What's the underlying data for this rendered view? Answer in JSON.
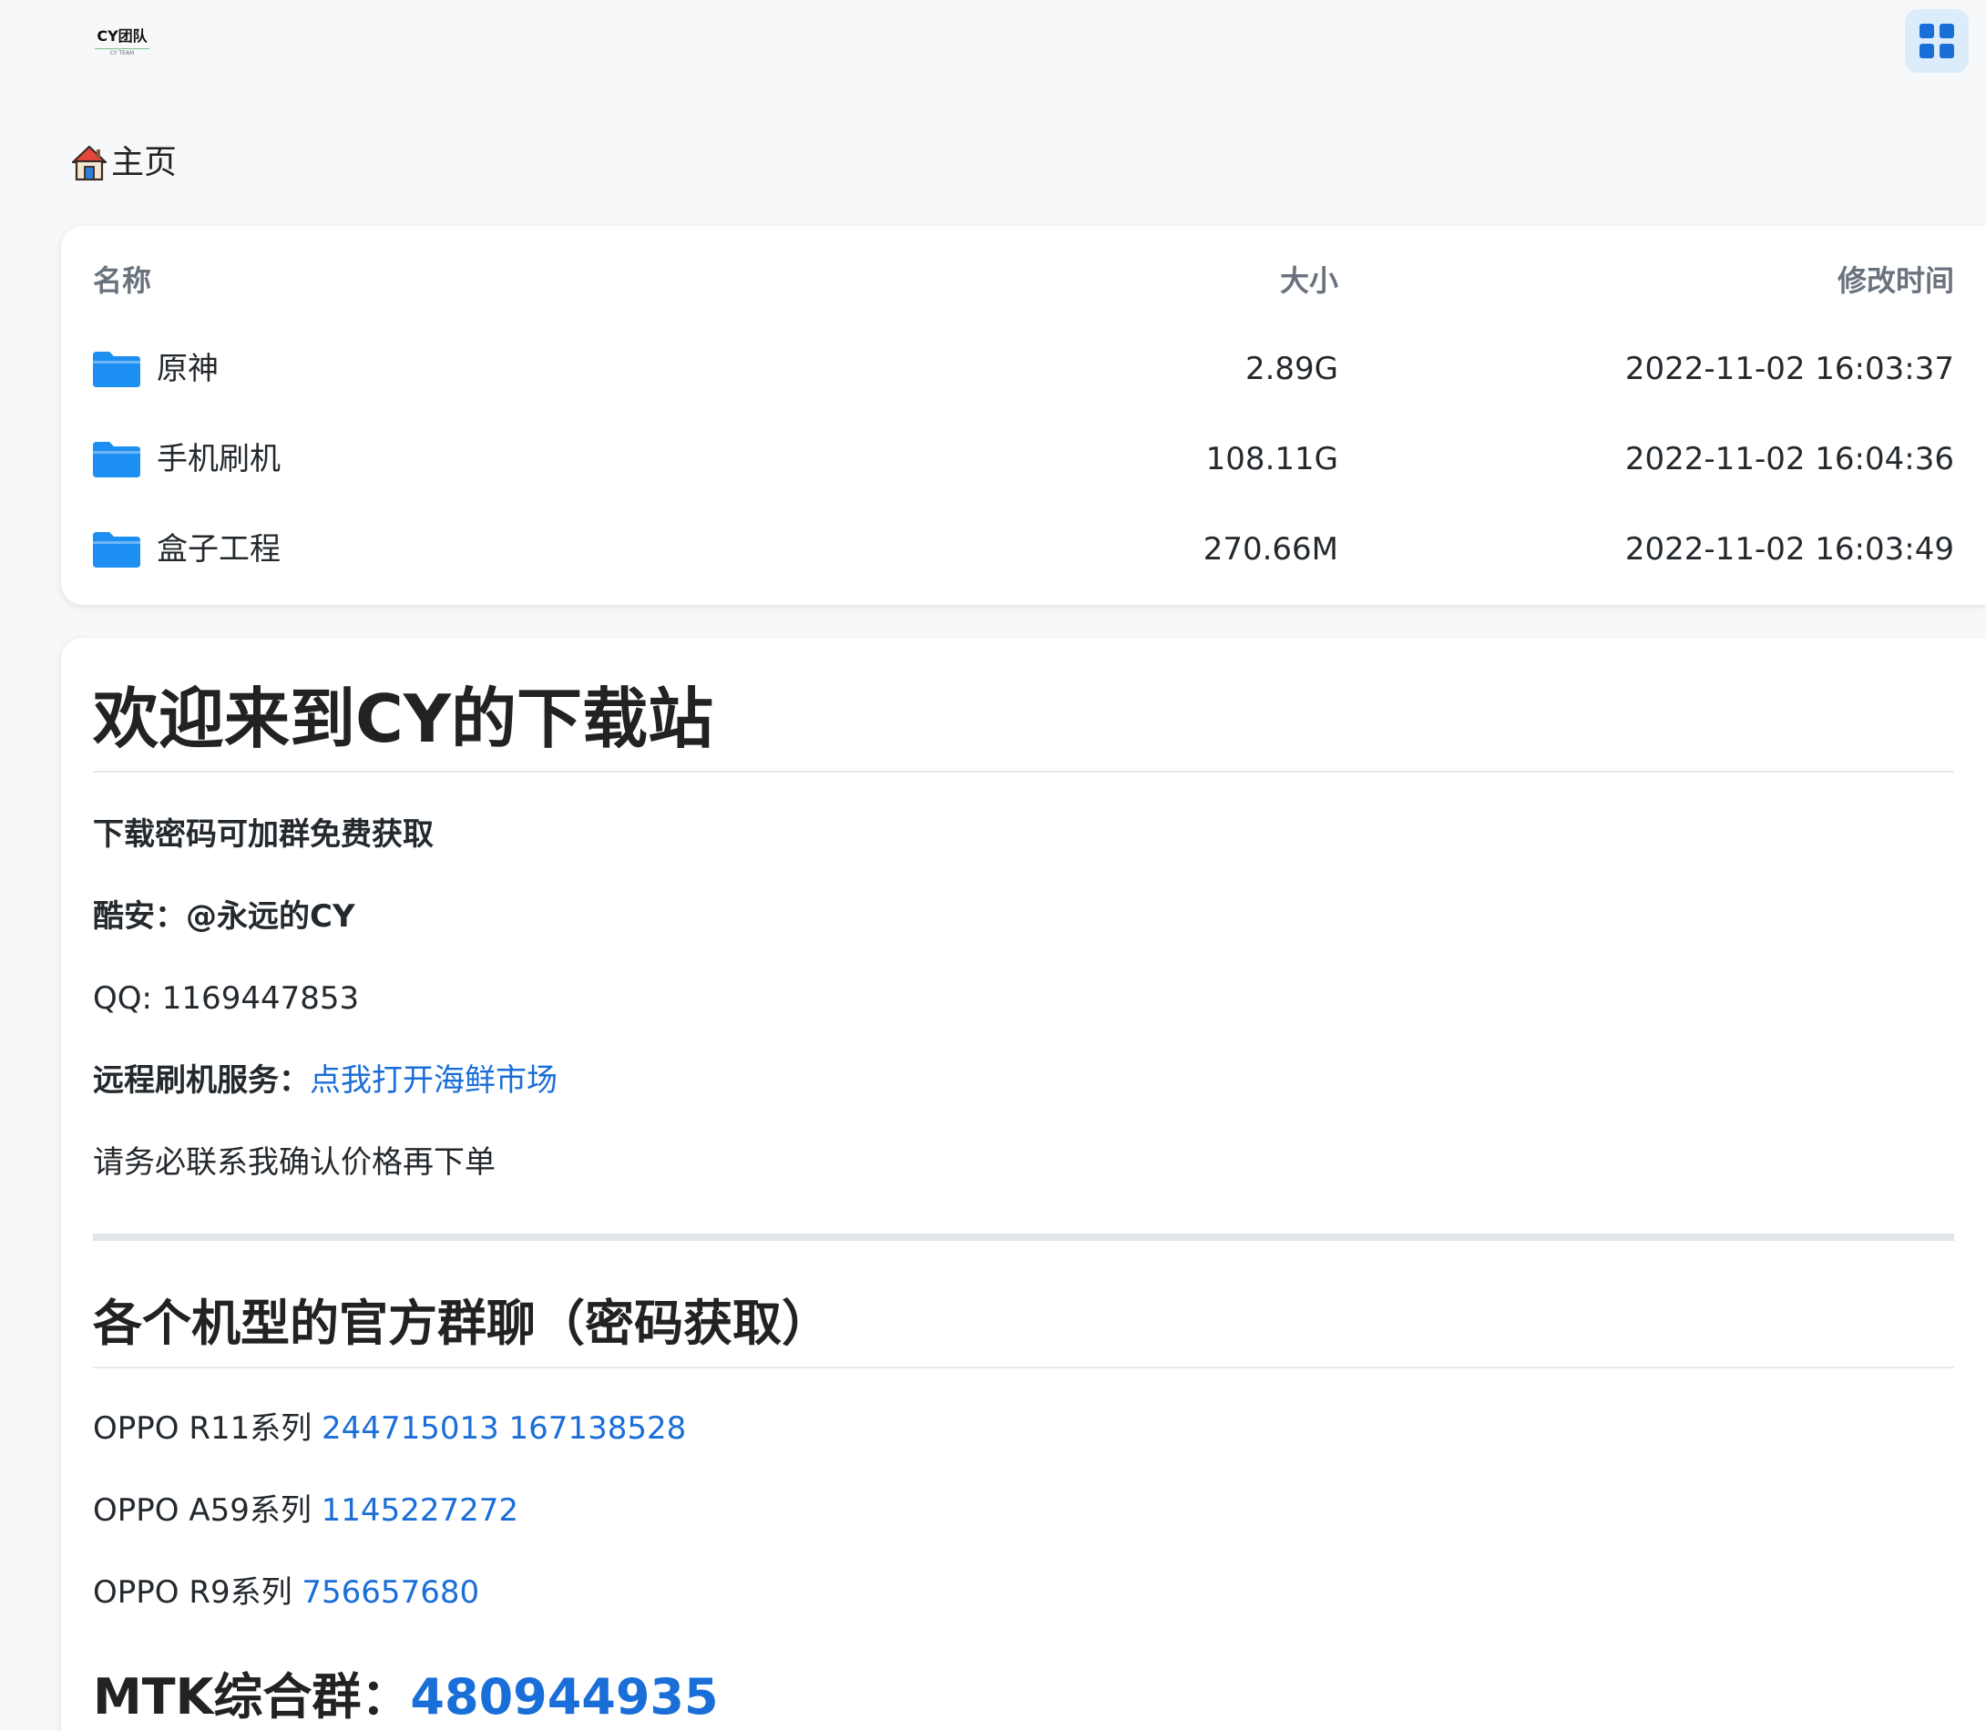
{
  "header": {
    "logo_text": "CY团队",
    "logo_subtext": "CY TEAM"
  },
  "breadcrumb": {
    "label": "主页"
  },
  "file_table": {
    "columns": {
      "name": "名称",
      "size": "大小",
      "time": "修改时间"
    },
    "rows": [
      {
        "name": "原神",
        "size": "2.89G",
        "time": "2022-11-02 16:03:37"
      },
      {
        "name": "手机刷机",
        "size": "108.11G",
        "time": "2022-11-02 16:04:36"
      },
      {
        "name": "盒子工程",
        "size": "270.66M",
        "time": "2022-11-02 16:03:49"
      }
    ]
  },
  "readme": {
    "title": "欢迎来到CY的下载站",
    "password_note": "下载密码可加群免费获取",
    "coolapk_label": "酷安：",
    "coolapk_value": "@永远的CY",
    "qq_label": "QQ: ",
    "qq_value": "1169447853",
    "remote_label": "远程刷机服务：",
    "remote_link": "点我打开海鲜市场",
    "confirm_note": "请务必联系我确认价格再下单",
    "groups_title": "各个机型的官方群聊（密码获取）",
    "groups": [
      {
        "label": "OPPO R11系列 ",
        "numbers": "244715013 167138528"
      },
      {
        "label": "OPPO A59系列 ",
        "numbers": "1145227272"
      },
      {
        "label": "OPPO R9系列 ",
        "numbers": "756657680"
      }
    ],
    "mtk_label": "MTK综合群：",
    "mtk_number": "480944935"
  },
  "colors": {
    "accent": "#1a6ed8",
    "folder": "#1e8ff2",
    "page_background": "#f7f8fa",
    "menu_button_bg": "#dcecfb"
  }
}
